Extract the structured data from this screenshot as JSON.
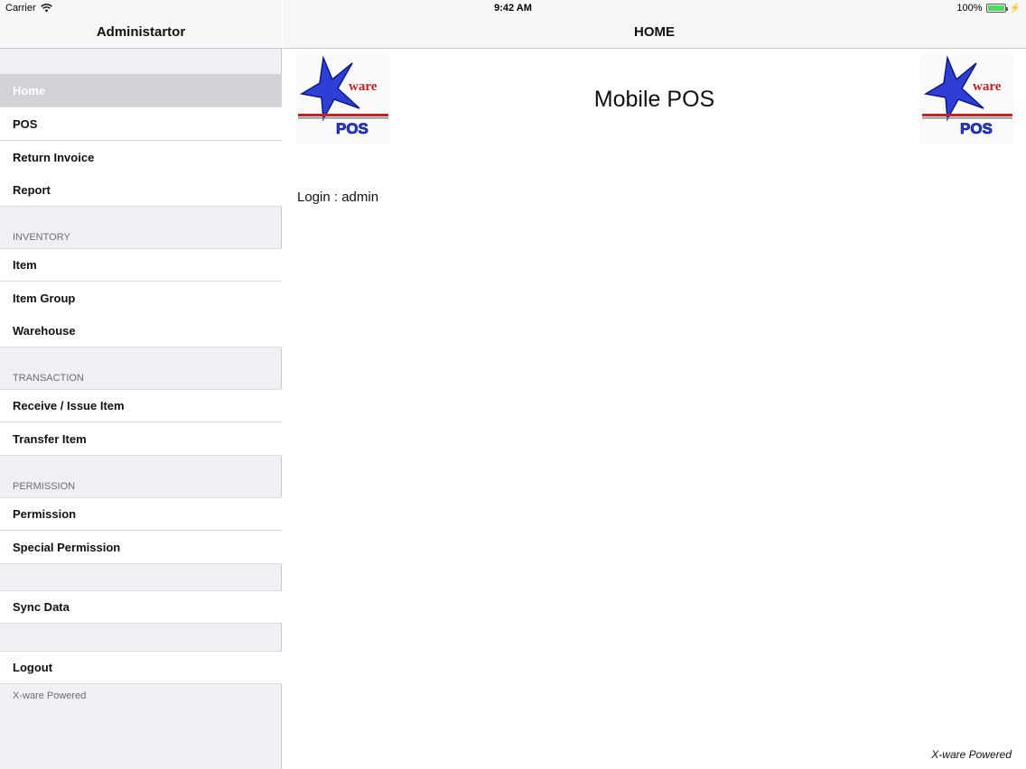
{
  "status_bar": {
    "carrier": "Carrier",
    "time": "9:42 AM",
    "battery": "100%"
  },
  "sidebar": {
    "title": "Administartor",
    "items_top": [
      {
        "label": "Home",
        "selected": true
      },
      {
        "label": "POS"
      },
      {
        "label": "Return Invoice"
      },
      {
        "label": "Report"
      }
    ],
    "inventory": {
      "header": "INVENTORY",
      "items": [
        {
          "label": "Item"
        },
        {
          "label": "Item Group"
        },
        {
          "label": "Warehouse"
        }
      ]
    },
    "transaction": {
      "header": "TRANSACTION",
      "items": [
        {
          "label": "Receive / Issue Item"
        },
        {
          "label": "Transfer Item"
        }
      ]
    },
    "permission": {
      "header": "PERMISSION",
      "items": [
        {
          "label": "Permission"
        },
        {
          "label": "Special Permission"
        }
      ]
    },
    "sync": {
      "label": "Sync Data"
    },
    "logout": {
      "label": "Logout"
    },
    "footer": "X-ware Powered"
  },
  "main": {
    "title": "HOME",
    "app_name": "Mobile POS",
    "logo_text": {
      "top": "ware",
      "bottom": "POS"
    },
    "login_info": "Login : admin",
    "powered": "X-ware Powered"
  },
  "colors": {
    "sidebar_bg": "#efeff4",
    "selected_bg": "#d1d1d6",
    "logo_blue": "#2f3fd6",
    "logo_red": "#cc1f1f",
    "battery_green": "#4cd964"
  }
}
